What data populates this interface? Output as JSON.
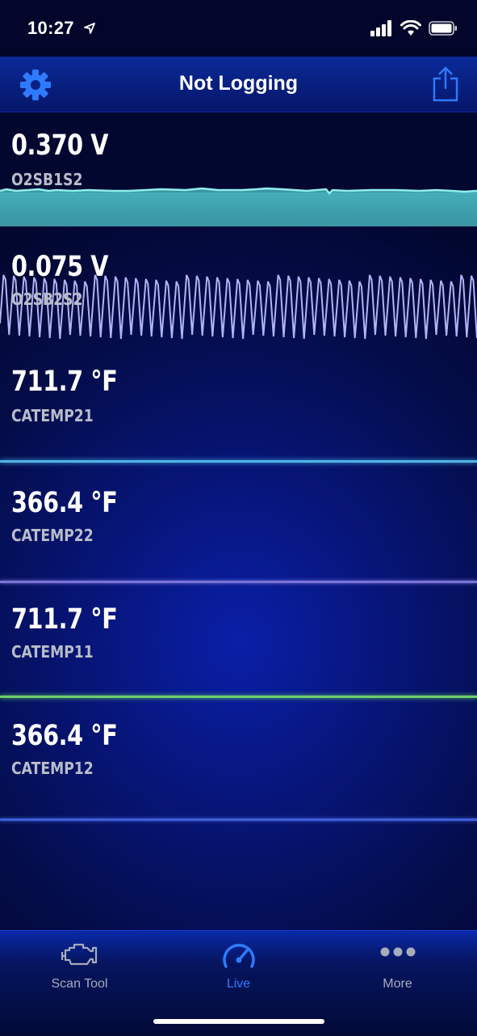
{
  "status_bar": {
    "time": "10:27"
  },
  "nav": {
    "title": "Not Logging",
    "settings_icon": "gear-icon",
    "share_icon": "share-icon"
  },
  "gauges": [
    {
      "value": "0.370 V",
      "label": "O2SB1S2",
      "color": "#5fd6d6"
    },
    {
      "value": "0.075 V",
      "label": "O2SB2S2",
      "color": "#a7a8f2"
    },
    {
      "value": "711.7 °F",
      "label": "CATEMP21",
      "color": "#4fb5e8"
    },
    {
      "value": "366.4 °F",
      "label": "CATEMP22",
      "color": "#7b74d8"
    },
    {
      "value": "711.7 °F",
      "label": "CATEMP11",
      "color": "#6bd06a"
    },
    {
      "value": "366.4 °F",
      "label": "CATEMP12",
      "color": "#3f5fd8"
    }
  ],
  "tabs": [
    {
      "label": "Scan Tool",
      "icon": "engine-icon",
      "active": false
    },
    {
      "label": "Live",
      "icon": "speedometer-icon",
      "active": true
    },
    {
      "label": "More",
      "icon": "ellipsis-icon",
      "active": false
    }
  ],
  "colors": {
    "accent": "#2f7bff",
    "inactive": "#a7abbc"
  }
}
